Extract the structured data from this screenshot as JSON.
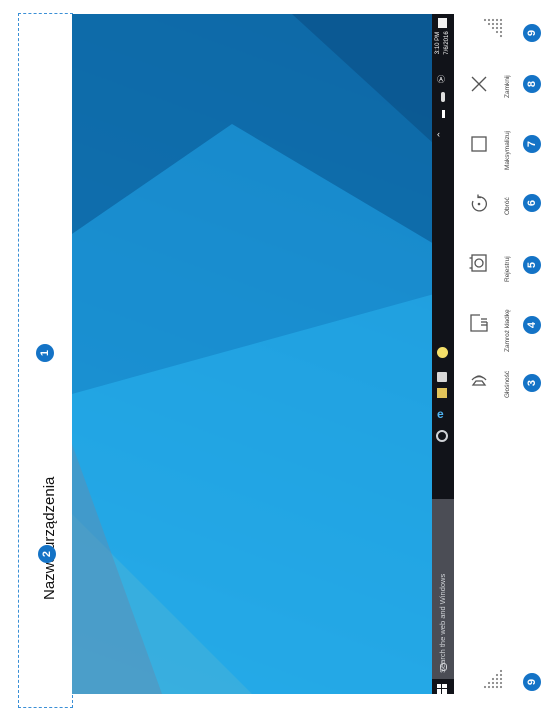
{
  "device_name": "Nazwa urządzenia",
  "taskbar": {
    "search_placeholder": "Search the web and Windows",
    "time": "3:10 PM",
    "date": "7/6/2016"
  },
  "controls": [
    {
      "id": "volume",
      "label": "Głośność",
      "icon": "speaker-icon"
    },
    {
      "id": "pin",
      "label": "Zamroź kładkę",
      "icon": "pin-panel-icon"
    },
    {
      "id": "capture",
      "label": "Rejestruj",
      "icon": "capture-icon"
    },
    {
      "id": "rotate",
      "label": "Obróć",
      "icon": "rotate-icon"
    },
    {
      "id": "maximize",
      "label": "Maksymalizuj",
      "icon": "maximize-icon"
    },
    {
      "id": "close",
      "label": "Zamknij",
      "icon": "close-icon"
    }
  ],
  "badges": {
    "b1": "1",
    "b2": "2",
    "b3": "3",
    "b4": "4",
    "b5": "5",
    "b6": "6",
    "b7": "7",
    "b8": "8",
    "b9_top": "9",
    "b9_bottom": "9"
  }
}
